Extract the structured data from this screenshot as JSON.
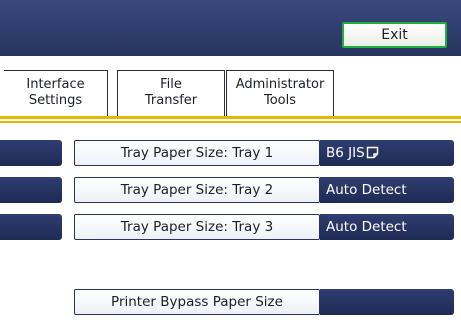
{
  "header": {
    "exit_label": "Exit"
  },
  "tabs": [
    {
      "line1": "Interface",
      "line2": "Settings"
    },
    {
      "line1": "File",
      "line2": "Transfer"
    },
    {
      "line1": "Administrator",
      "line2": "Tools"
    }
  ],
  "rows": [
    {
      "label": "Tray Paper Size: Tray 1",
      "value": "B6 JIS"
    },
    {
      "label": "Tray Paper Size: Tray 2",
      "value": "Auto Detect"
    },
    {
      "label": "Tray Paper Size: Tray 3",
      "value": "Auto Detect"
    },
    {
      "label": "Printer Bypass Paper Size",
      "value": ""
    }
  ],
  "icons": {
    "tray1_value_icon": "paper-orientation-icon"
  },
  "colors": {
    "header_navy": "#26335f",
    "exit_border": "#1eb03a",
    "tab_accent": "#e8b800",
    "value_navy": "#1f2b56"
  }
}
